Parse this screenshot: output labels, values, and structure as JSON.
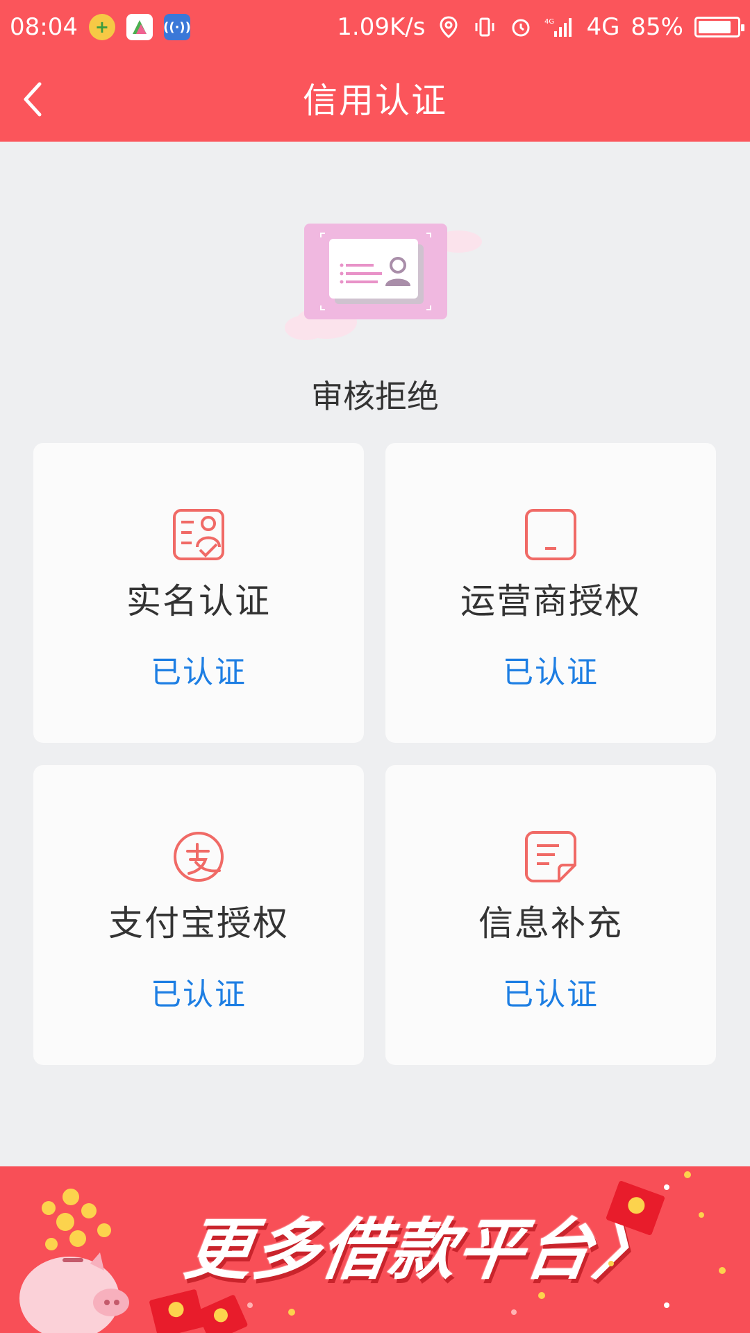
{
  "status_bar": {
    "time": "08:04",
    "net_speed": "1.09K/s",
    "network": "4G",
    "battery": "85%",
    "battery_level": 0.85
  },
  "header": {
    "title": "信用认证"
  },
  "review": {
    "status": "审核拒绝"
  },
  "cards": [
    {
      "title": "实名认证",
      "status": "已认证",
      "icon": "id-card-icon"
    },
    {
      "title": "运营商授权",
      "status": "已认证",
      "icon": "phone-icon"
    },
    {
      "title": "支付宝授权",
      "status": "已认证",
      "icon": "alipay-icon"
    },
    {
      "title": "信息补充",
      "status": "已认证",
      "icon": "document-icon"
    }
  ],
  "banner": {
    "text": "更多借款平台〉"
  },
  "colors": {
    "primary": "#fb555b",
    "link": "#1d7ee3",
    "background": "#eeeff1"
  }
}
